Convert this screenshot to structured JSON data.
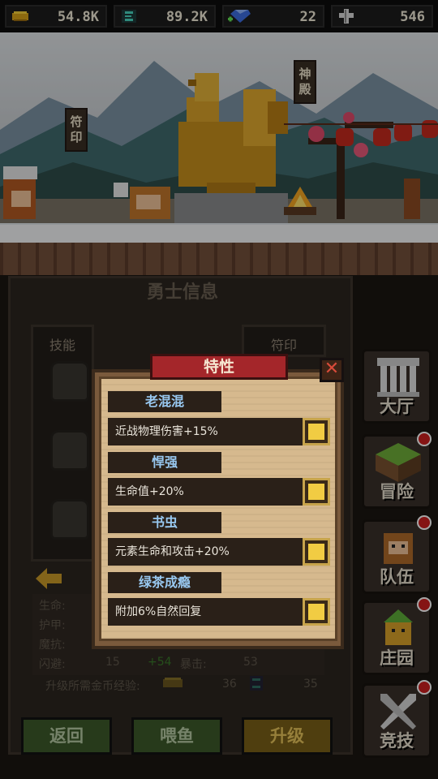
{
  "resources": {
    "gold": "54.8K",
    "energy": "89.2K",
    "gems": "22",
    "cross": "546"
  },
  "scene": {
    "left_banner": "符印",
    "right_banner": "神殿"
  },
  "panel": {
    "title": "勇士信息",
    "tab_skills": "技能",
    "tab_runes": "符印",
    "stats": {
      "hp_label": "生命:",
      "armor_label": "护甲:",
      "resist_label": "魔抗:",
      "dodge_label": "闪避:",
      "dodge_value": "15",
      "dodge_bonus": "+54",
      "crit_label": "暴击:",
      "crit_value": "53",
      "upgrade_label": "升级所需金币经验:",
      "upgrade_gold": "36",
      "upgrade_energy": "35"
    },
    "buttons": {
      "back": "返回",
      "feed": "喂鱼",
      "upgrade": "升级"
    }
  },
  "nav": {
    "hall": "大厅",
    "adventure": "冒险",
    "team": "队伍",
    "manor": "庄园",
    "arena": "竞技"
  },
  "dialog": {
    "title": "特性",
    "traits": [
      {
        "name": "老混混",
        "desc": "近战物理伤害+15%"
      },
      {
        "name": "悍强",
        "desc": "生命值+20%"
      },
      {
        "name": "书虫",
        "desc": "元素生命和攻击+20%"
      },
      {
        "name": "绿茶成瘾",
        "desc": "附加6%自然回复"
      }
    ]
  },
  "colors": {
    "accent_red": "#a4262a",
    "trait_blue": "#98c8f0",
    "gold": "#f1cc43"
  }
}
